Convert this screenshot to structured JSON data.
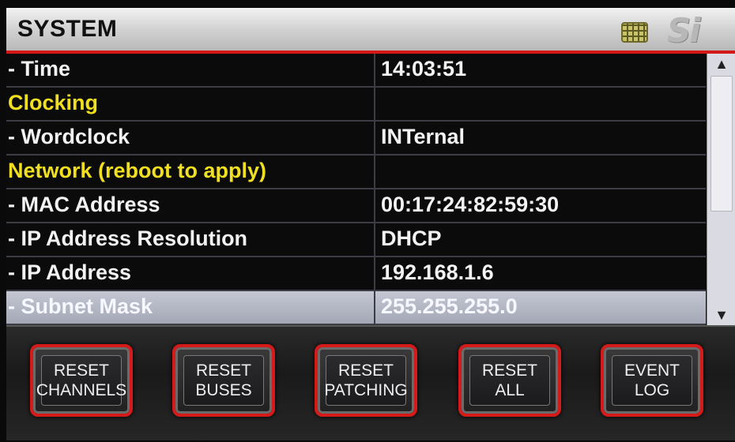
{
  "header": {
    "title": "SYSTEM",
    "keypad_icon": "keypad-icon",
    "logo": "Si"
  },
  "table": {
    "rows": [
      {
        "label": "- Time",
        "value": "14:03:51",
        "type": "item"
      },
      {
        "label": "Clocking",
        "value": "",
        "type": "section"
      },
      {
        "label": "- Wordclock",
        "value": "INTernal",
        "type": "item"
      },
      {
        "label": "Network (reboot to apply)",
        "value": "",
        "type": "section"
      },
      {
        "label": "- MAC Address",
        "value": "00:17:24:82:59:30",
        "type": "item"
      },
      {
        "label": "- IP Address Resolution",
        "value": "DHCP",
        "type": "item"
      },
      {
        "label": "- IP Address",
        "value": "192.168.1.6",
        "type": "item"
      },
      {
        "label": "- Subnet Mask",
        "value": "255.255.255.0",
        "type": "selected"
      }
    ]
  },
  "scrollbar": {
    "up_icon": "▲",
    "down_icon": "▼",
    "position_fraction": 0.0
  },
  "buttons": [
    {
      "line1": "RESET",
      "line2": "CHANNELS"
    },
    {
      "line1": "RESET",
      "line2": "BUSES"
    },
    {
      "line1": "RESET",
      "line2": "PATCHING"
    },
    {
      "line1": "RESET",
      "line2": "ALL"
    },
    {
      "line1": "EVENT",
      "line2": "LOG"
    }
  ],
  "colors": {
    "accent_red": "#d41818",
    "section_yellow": "#f0e020",
    "selected_row": "#b4b8c4"
  }
}
